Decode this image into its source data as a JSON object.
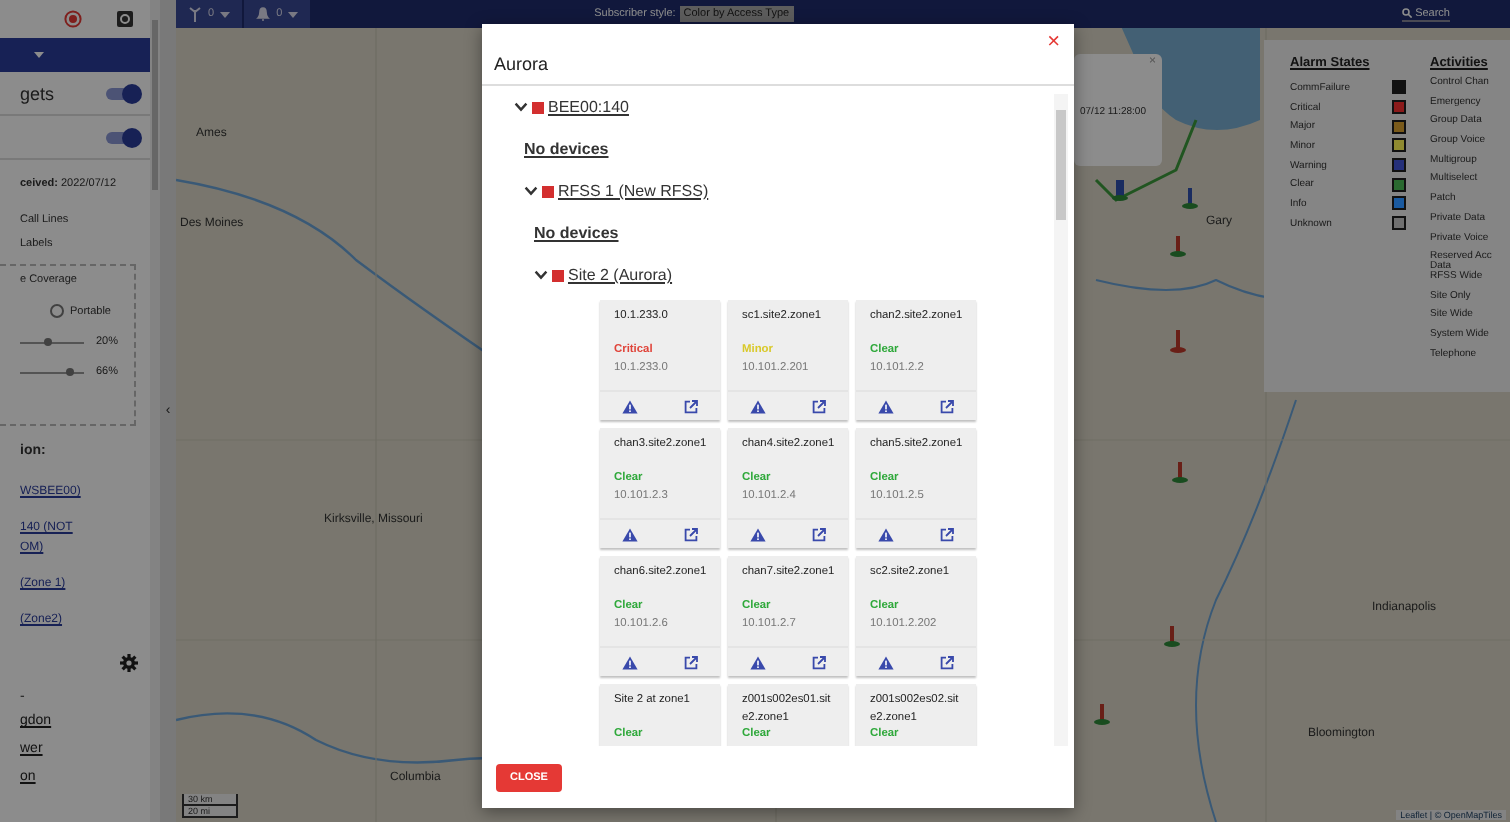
{
  "sidebar": {
    "toggles": [
      {
        "label": "gets",
        "on": true
      },
      {
        "on": true
      }
    ],
    "received": "**ceived:** 2022/07/12",
    "options": [
      "Call Lines",
      "Labels"
    ],
    "coverage": {
      "title": "e Coverage",
      "radio": {
        "label": "Portable",
        "selected": false
      },
      "sliders": [
        {
          "level": 0.45,
          "reading": "20%"
        },
        {
          "level": 0.78,
          "reading": "66%"
        }
      ]
    },
    "section_title": "ion:",
    "links": [
      "WSBEE00)",
      "140 (NOT",
      "OM)",
      "(Zone 1)",
      "(Zone2)"
    ],
    "dash": "-",
    "lower_links": [
      "gdon",
      "wer",
      "on"
    ]
  },
  "collapse": "‹",
  "top_bar": {
    "filters": [
      {
        "kind": "antenna",
        "count": "0"
      },
      {
        "kind": "bell",
        "count": "0"
      }
    ],
    "style_label": "Subscriber style:",
    "style_value": "Color by Access Type",
    "search": "Search"
  },
  "map": {
    "labels": [
      "Ames",
      "Des Moines",
      "Kirksville, Missouri",
      "Columbia",
      "Gary",
      "Indianapolis",
      "Bloomington"
    ],
    "scale": [
      "30 km",
      "20 mi"
    ],
    "attribution": "Leaflet | © OpenMapTiles",
    "popup": {
      "text": "07/12 11:28:00",
      "close": "×"
    }
  },
  "legend": {
    "alarm_title": "Alarm States",
    "alarms": [
      {
        "label": "CommFailure",
        "color": "#111111"
      },
      {
        "label": "Critical",
        "color": "#8b1a1a"
      },
      {
        "label": "Major",
        "color": "#7a5a1a"
      },
      {
        "label": "Minor",
        "color": "#8f8a30"
      },
      {
        "label": "Warning",
        "color": "#25307a"
      },
      {
        "label": "Clear",
        "color": "#2a6a30"
      },
      {
        "label": "Info",
        "color": "#1a5aa0"
      },
      {
        "label": "Unknown",
        "color": "#707070"
      }
    ],
    "activity_title": "Activities",
    "activities": [
      "Control Chan",
      "Emergency",
      "Group Data",
      "Group Voice",
      "Multigroup",
      "Multiselect",
      "Patch",
      "Private Data",
      "Private Voice",
      "Reserved Acc Data",
      "RFSS Wide",
      "Site Only",
      "Site Wide",
      "System Wide",
      "Telephone"
    ]
  },
  "modal": {
    "title": "Aurora",
    "close": "×",
    "button": "CLOSE",
    "tree": [
      {
        "kind": "node",
        "label": "BEE00:140",
        "color": "#d32f2f",
        "expanded": true,
        "children": [
          {
            "kind": "note",
            "label": "No devices"
          },
          {
            "kind": "node",
            "label": "RFSS 1 (New RFSS)",
            "color": "#d32f2f",
            "expanded": true,
            "children": [
              {
                "kind": "note",
                "label": "No devices"
              },
              {
                "kind": "node",
                "label": "Site 2 (Aurora)",
                "color": "#d32f2f",
                "expanded": true,
                "devices": [
                  {
                    "name": "10.1.233.0",
                    "status": "Critical",
                    "color": "#e0443a",
                    "ip": "10.1.233.0"
                  },
                  {
                    "name": "sc1.site2.zone1",
                    "status": "Minor",
                    "color": "#d9c92a",
                    "ip": "10.101.2.201"
                  },
                  {
                    "name": "chan2.site2.zone1",
                    "status": "Clear",
                    "color": "#2ea83a",
                    "ip": "10.101.2.2"
                  },
                  {
                    "name": "chan3.site2.zone1",
                    "status": "Clear",
                    "color": "#2ea83a",
                    "ip": "10.101.2.3"
                  },
                  {
                    "name": "chan4.site2.zone1",
                    "status": "Clear",
                    "color": "#2ea83a",
                    "ip": "10.101.2.4"
                  },
                  {
                    "name": "chan5.site2.zone1",
                    "status": "Clear",
                    "color": "#2ea83a",
                    "ip": "10.101.2.5"
                  },
                  {
                    "name": "chan6.site2.zone1",
                    "status": "Clear",
                    "color": "#2ea83a",
                    "ip": "10.101.2.6"
                  },
                  {
                    "name": "chan7.site2.zone1",
                    "status": "Clear",
                    "color": "#2ea83a",
                    "ip": "10.101.2.7"
                  },
                  {
                    "name": "sc2.site2.zone1",
                    "status": "Clear",
                    "color": "#2ea83a",
                    "ip": "10.101.2.202"
                  },
                  {
                    "name": "Site 2 at zone1",
                    "status": "Clear",
                    "color": "#2ea83a"
                  },
                  {
                    "name": "z001s002es01.site2.zone1",
                    "status": "Clear",
                    "color": "#2ea83a"
                  },
                  {
                    "name": "z001s002es02.site2.zone1",
                    "status": "Clear",
                    "color": "#2ea83a"
                  }
                ]
              }
            ]
          }
        ]
      }
    ]
  }
}
